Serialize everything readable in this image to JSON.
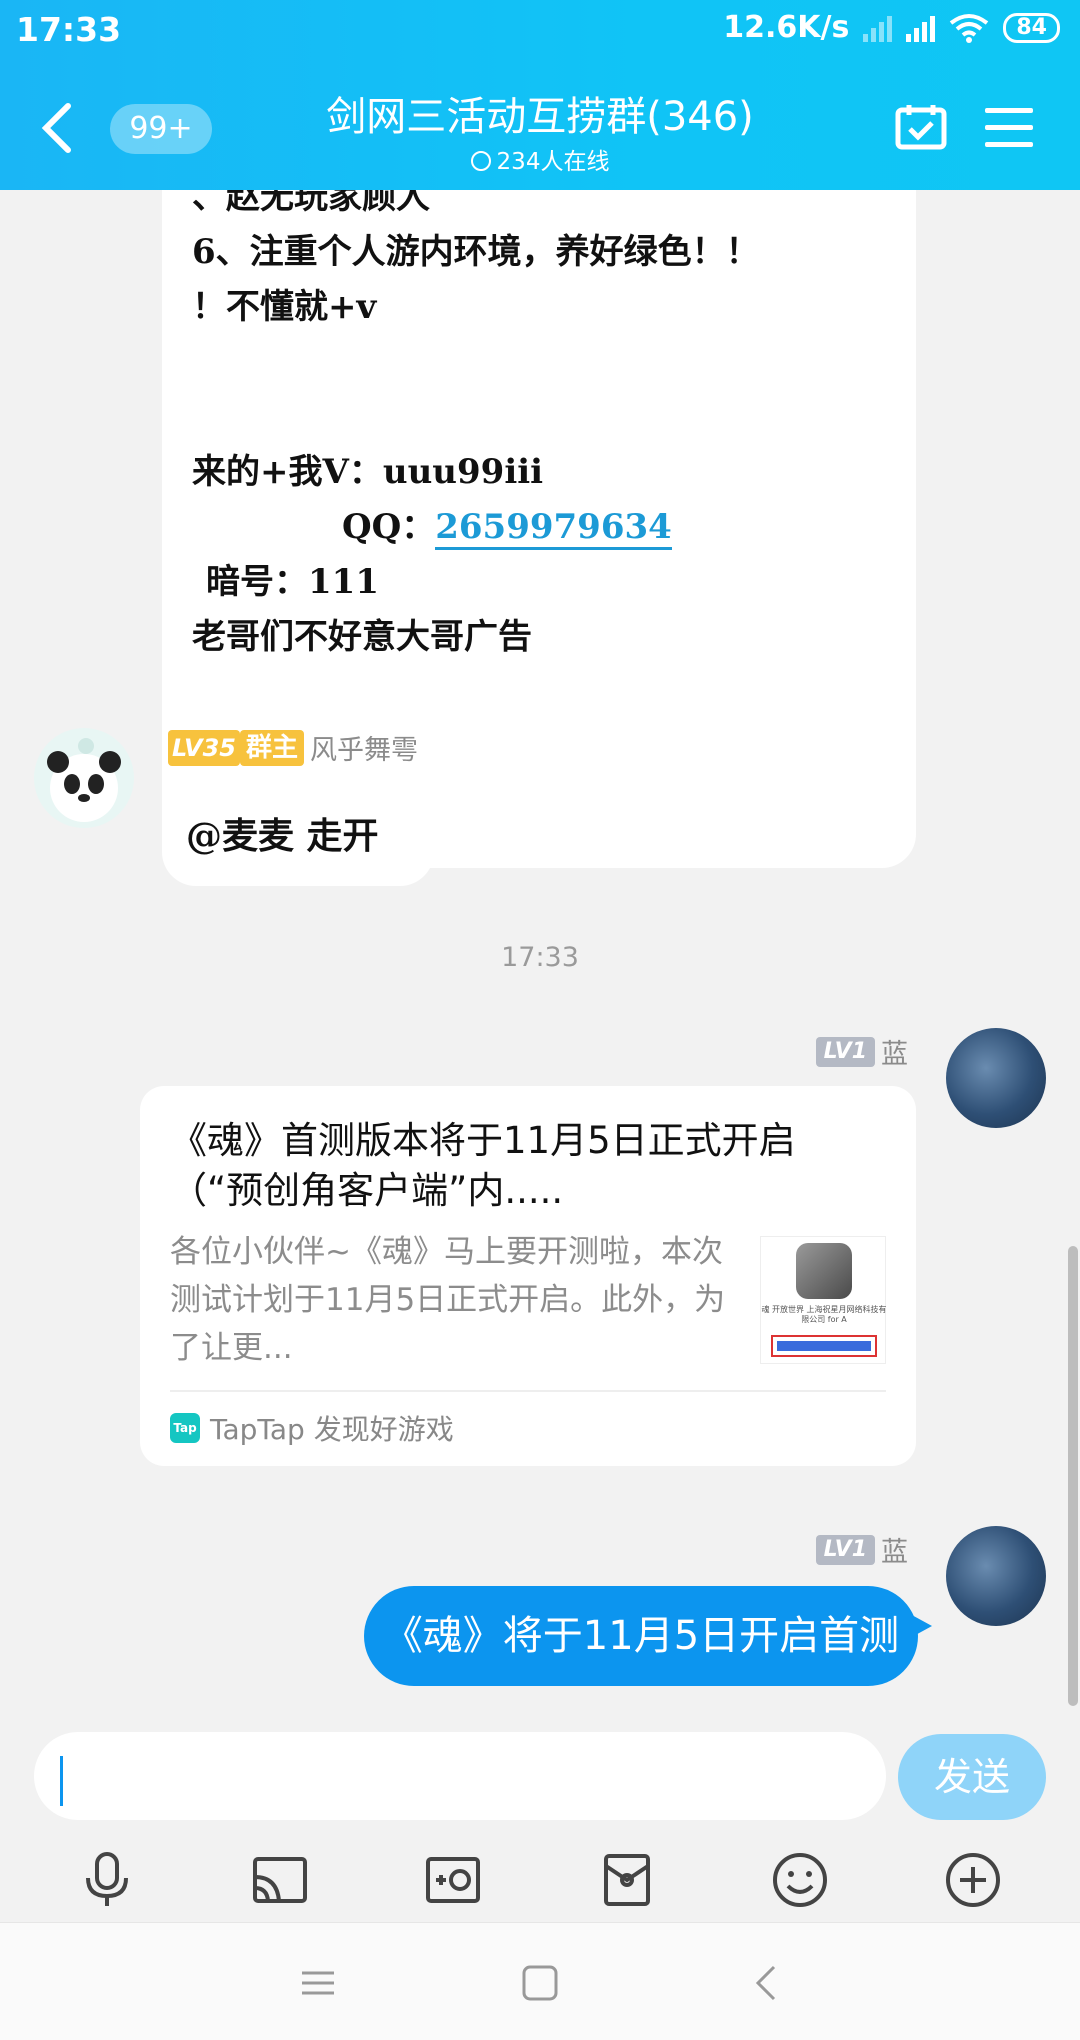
{
  "status": {
    "time": "17:33",
    "speed": "12.6K/s",
    "battery": "84"
  },
  "header": {
    "unread": "99+",
    "title": "剑网三活动互捞群(346)",
    "online": "234人在线"
  },
  "messages": {
    "first": {
      "lines": [
        "、赵无玩家顾人",
        "6、注重个人游内环境，养好绿色！！",
        "！不懂就+v",
        "",
        "",
        "来的+我V：uuu99iii",
        "QQ：",
        "暗号：111",
        "老哥们不好意大哥广告"
      ],
      "qq": "2659979634"
    },
    "owner_msg": {
      "level": "LV35",
      "role": "群主",
      "name": "风乎舞雩",
      "text": "@麦麦 走开"
    },
    "timestamp": "17:33",
    "card_msg": {
      "level": "LV1",
      "name": "蓝",
      "title": "《魂》首测版本将于11月5日正式开启（“预创角客户端”内.....",
      "desc": "各位小伙伴~《魂》马上要开测啦，本次测试计划于11月5日正式开启。此外，为了让更...",
      "thumb_text": "魂 开放世界 上海祝星月网络科技有限公司 for A",
      "source": "TapTap 发现好游戏",
      "source_icon": "Tap"
    },
    "blue_msg": {
      "level": "LV1",
      "name": "蓝",
      "text": "《魂》将于11月5日开启首测"
    }
  },
  "input": {
    "placeholder": "",
    "send": "发送"
  },
  "tools": [
    "mic-icon",
    "screen-cast-icon",
    "photo-icon",
    "red-packet-icon",
    "emoji-icon",
    "plus-icon"
  ],
  "colors": {
    "header": "#10c4f6",
    "bubble_blue": "#0c95ef",
    "send_btn": "#8fd4f9",
    "owner_badge": "#f7c23d"
  }
}
